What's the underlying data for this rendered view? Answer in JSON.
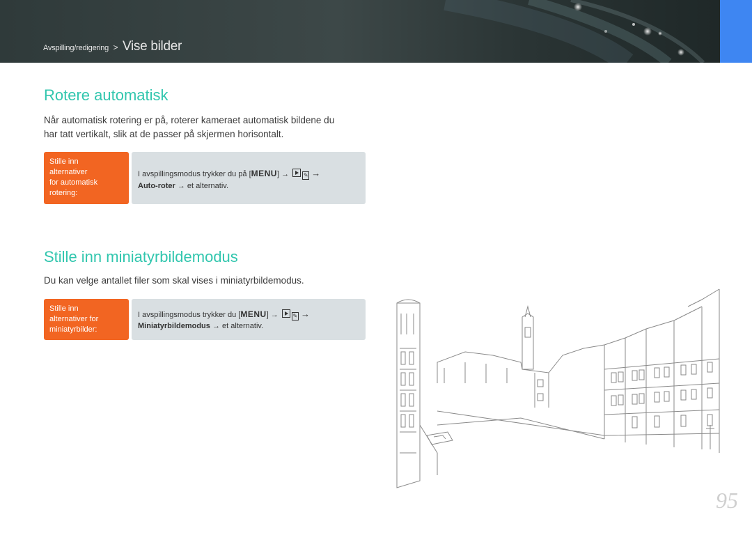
{
  "header": {
    "breadcrumb_parent": "Avspilling/redigering",
    "breadcrumb_separator": ">",
    "breadcrumb_current": "Vise bilder",
    "accent_tab_color": "#3e86f2"
  },
  "sections": [
    {
      "title": "Rotere automatisk",
      "description_lines": [
        "Når automatisk rotering er på, roterer kameraet automatisk bildene du",
        "har tatt vertikalt, slik at de passer på skjermen horisontalt."
      ],
      "label_lines": [
        "Stille inn",
        "alternativer",
        "for automatisk",
        "rotering:"
      ],
      "step": {
        "prefix": "I avspillingsmodus trykker du på [",
        "menu_key": "MENU",
        "suffix": "] →",
        "after_icons": "→",
        "option": "Auto-roter",
        "option_suffix": "→ et alternativ."
      }
    },
    {
      "title": "Stille inn miniatyrbildemodus",
      "description_lines": [
        "Du kan velge antallet filer som skal vises i miniatyrbildemodus."
      ],
      "label_lines": [
        "Stille inn",
        "alternativer for",
        "miniatyrbilder:"
      ],
      "step": {
        "prefix": "I avspillingsmodus trykker du [",
        "menu_key": "MENU",
        "suffix": "] →",
        "after_icons": "→",
        "option": "Miniatyrbildemodus",
        "option_suffix": "→ et alternativ."
      }
    }
  ],
  "icons": [
    "play-mode-icon",
    "edit-mode-icon"
  ],
  "illustration": "venice-canal-sketch",
  "page_number": "95",
  "colors": {
    "title": "#31c6ae",
    "label_bg": "#f26522",
    "step_bg": "#d9dfe2",
    "header_bg": "#2f3a3a"
  }
}
